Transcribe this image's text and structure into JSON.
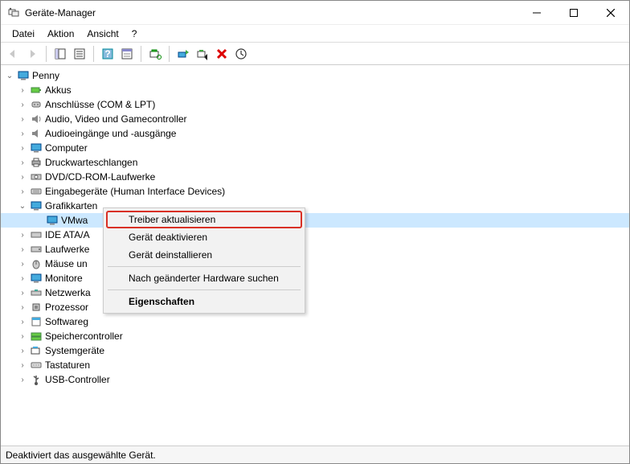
{
  "window": {
    "title": "Geräte-Manager"
  },
  "menu": {
    "file": "Datei",
    "action": "Aktion",
    "view": "Ansicht",
    "help": "?"
  },
  "tree": {
    "root": "Penny",
    "categories": {
      "batteries": "Akkus",
      "ports": "Anschlüsse (COM & LPT)",
      "audio": "Audio, Video und Gamecontroller",
      "audioio": "Audioeingänge und -ausgänge",
      "computer": "Computer",
      "printq": "Druckwarteschlangen",
      "dvd": "DVD/CD-ROM-Laufwerke",
      "hid": "Eingabegeräte (Human Interface Devices)",
      "display": "Grafikkarten",
      "display_child": "VMwa",
      "ide": "IDE ATA/A",
      "drives": "Laufwerke",
      "mice": "Mäuse un",
      "monitors": "Monitore",
      "net": "Netzwerka",
      "cpu": "Prozessor",
      "soft": "Softwareg",
      "storage": "Speichercontroller",
      "system": "Systemgeräte",
      "keyboards": "Tastaturen",
      "usb": "USB-Controller"
    }
  },
  "context": {
    "updateDriver": "Treiber aktualisieren",
    "disable": "Gerät deaktivieren",
    "uninstall": "Gerät deinstallieren",
    "scan": "Nach geänderter Hardware suchen",
    "properties": "Eigenschaften"
  },
  "status": "Deaktiviert das ausgewählte Gerät."
}
